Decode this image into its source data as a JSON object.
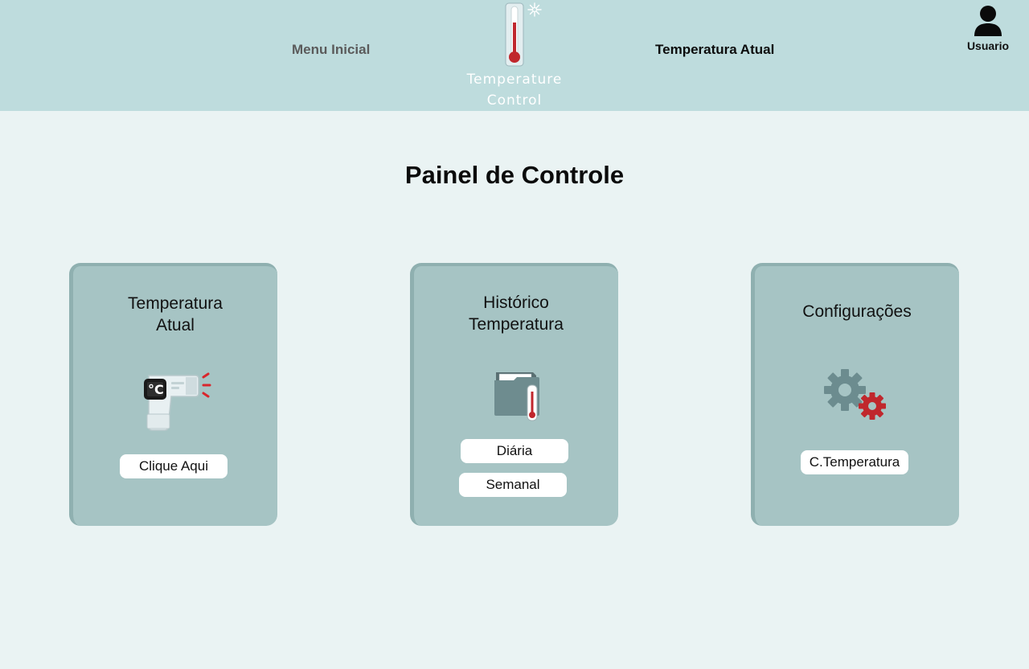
{
  "header": {
    "nav_home": "Menu Inicial",
    "nav_current": "Temperatura Atual",
    "logo_line1": "Temperature",
    "logo_line2": "Control",
    "user_label": "Usuario"
  },
  "main": {
    "title": "Painel de Controle",
    "cards": [
      {
        "title_line1": "Temperatura",
        "title_line2": "Atual",
        "icon": "thermometer-gun-icon",
        "buttons": [
          "Clique Aqui"
        ]
      },
      {
        "title_line1": "Histórico",
        "title_line2": "Temperatura",
        "icon": "folder-thermometer-icon",
        "buttons": [
          "Diária",
          "Semanal"
        ]
      },
      {
        "title_line1": "Configurações",
        "icon": "gears-icon",
        "buttons": [
          "C.Temperatura"
        ]
      }
    ]
  },
  "colors": {
    "header_bg": "#bedcdd",
    "page_bg": "#eaf3f3",
    "card_bg": "#a6c4c4",
    "accent_red": "#c0272d",
    "gear_gray": "#6c8c8f"
  }
}
